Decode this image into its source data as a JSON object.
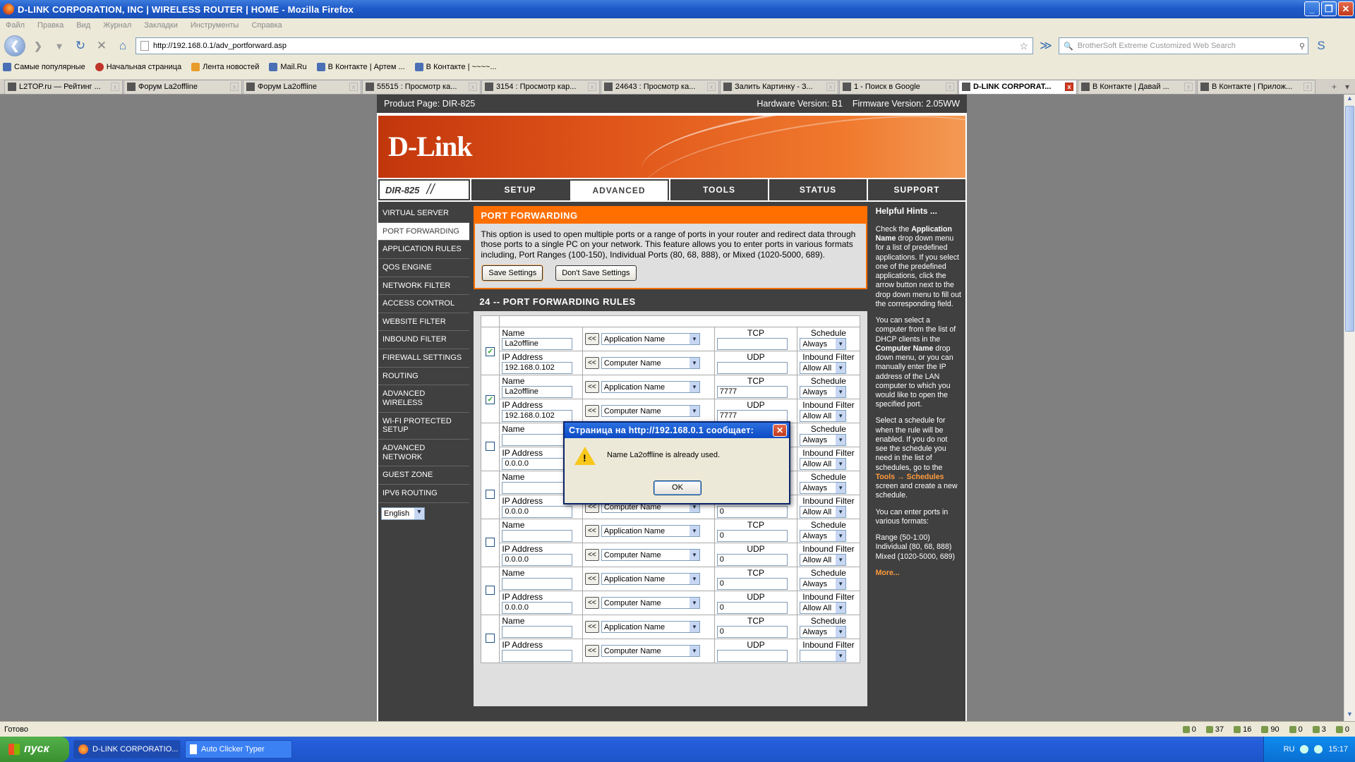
{
  "window": {
    "title": "D-LINK CORPORATION, INC | WIRELESS ROUTER | HOME - Mozilla Firefox"
  },
  "menu": [
    "Файл",
    "Правка",
    "Вид",
    "Журнал",
    "Закладки",
    "Инструменты",
    "Справка"
  ],
  "nav": {
    "url": "http://192.168.0.1/adv_portforward.asp",
    "search_placeholder": "BrotherSoft Extreme Customized Web Search"
  },
  "bookmarks": [
    "Самые популярные",
    "Начальная страница",
    "Лента новостей",
    "Mail.Ru",
    "В Контакте | Артем ...",
    "В Контакте | ~~~~..."
  ],
  "tabs": [
    {
      "label": "L2TOP.ru — Рейтинг ..."
    },
    {
      "label": "Форум La2offline"
    },
    {
      "label": "Форум La2offline"
    },
    {
      "label": "55515 : Просмотр ка..."
    },
    {
      "label": "3154 : Просмотр кар..."
    },
    {
      "label": "24643 : Просмотр ка..."
    },
    {
      "label": "Залить Картинку - З..."
    },
    {
      "label": "1 - Поиск в Google"
    },
    {
      "label": "D-LINK CORPORAT...",
      "active": true
    },
    {
      "label": "В Контакте | Давай ..."
    },
    {
      "label": "В Контакте | Прилож..."
    }
  ],
  "router": {
    "product_page": "Product Page: DIR-825",
    "hardware": "Hardware Version: B1",
    "firmware": "Firmware Version: 2.05WW",
    "logo": "D-Link",
    "model": "DIR-825",
    "topnav": [
      "SETUP",
      "ADVANCED",
      "TOOLS",
      "STATUS",
      "SUPPORT"
    ],
    "sidenav": [
      "VIRTUAL SERVER",
      "PORT FORWARDING",
      "APPLICATION RULES",
      "QOS ENGINE",
      "NETWORK FILTER",
      "ACCESS CONTROL",
      "WEBSITE FILTER",
      "INBOUND FILTER",
      "FIREWALL SETTINGS",
      "ROUTING",
      "ADVANCED WIRELESS",
      "WI-FI PROTECTED SETUP",
      "ADVANCED NETWORK",
      "GUEST ZONE",
      "IPV6 ROUTING"
    ],
    "language": "English",
    "pf_title": "PORT FORWARDING",
    "pf_desc": "This option is used to open multiple ports or a range of ports in your router and redirect data through those ports to a single PC on your network. This feature allows you to enter ports in various formats including, Port Ranges (100-150), Individual Ports (80, 68, 888), or Mixed (1020-5000, 689).",
    "save_label": "Save Settings",
    "dont_save_label": "Don't Save Settings",
    "rules_title": "24 -- PORT FORWARDING RULES",
    "labels": {
      "name": "Name",
      "ip": "IP Address",
      "tcp": "TCP",
      "udp": "UDP",
      "schedule": "Schedule",
      "inbound": "Inbound Filter",
      "app_name": "Application Name",
      "computer_name": "Computer Name",
      "arrow": "<<"
    },
    "rules": [
      {
        "checked": true,
        "name": "La2offline",
        "ip": "192.168.0.102",
        "tcp": "",
        "udp": "",
        "schedule": "Always",
        "inbound": "Allow All"
      },
      {
        "checked": true,
        "name": "La2offline",
        "ip": "192.168.0.102",
        "tcp": "7777",
        "udp": "7777",
        "schedule": "Always",
        "inbound": "Allow All"
      },
      {
        "checked": false,
        "name": "",
        "ip": "0.0.0.0",
        "tcp": "0",
        "udp": "0",
        "schedule": "Always",
        "inbound": "Allow All"
      },
      {
        "checked": false,
        "name": "",
        "ip": "0.0.0.0",
        "tcp": "0",
        "udp": "0",
        "schedule": "Always",
        "inbound": "Allow All"
      },
      {
        "checked": false,
        "name": "",
        "ip": "0.0.0.0",
        "tcp": "0",
        "udp": "0",
        "schedule": "Always",
        "inbound": "Allow All"
      },
      {
        "checked": false,
        "name": "",
        "ip": "0.0.0.0",
        "tcp": "0",
        "udp": "0",
        "schedule": "Always",
        "inbound": "Allow All"
      },
      {
        "checked": false,
        "name": "",
        "ip": "",
        "tcp": "0",
        "udp": "",
        "schedule": "Always",
        "inbound": ""
      }
    ],
    "hints": {
      "title": "Helpful Hints ...",
      "p1a": "Check the",
      "p1b": "Application Name",
      "p1c": "drop down menu for a list of predefined applications. If you select one of the predefined applications, click the arrow button next to the drop down menu to fill out the corresponding field.",
      "p2a": "You can select a computer from the list of DHCP clients in the",
      "p2b": "Computer Name",
      "p2c": "drop down menu, or you can manually enter the IP address of the LAN computer to which you would like to open the specified port.",
      "p3a": "Select a schedule for when the rule will be enabled. If you do not see the schedule you need in the list of schedules, go to the",
      "p3b": "Tools → Schedules",
      "p3c": "screen and create a new schedule.",
      "p4": "You can enter ports in various formats:",
      "p5a": "Range (50-1:00)",
      "p5b": "Individual (80, 68, 888)",
      "p5c": "Mixed (1020-5000, 689)",
      "more": "More..."
    }
  },
  "dialog": {
    "title": "Страница на http://192.168.0.1 сообщает:",
    "message": "Name La2offline is already used.",
    "ok": "OK"
  },
  "status": {
    "text": "Готово",
    "counts": [
      "0",
      "37",
      "16",
      "90",
      "0",
      "3",
      "0"
    ]
  },
  "taskbar": {
    "start": "пуск",
    "tasks": [
      "D-LINK CORPORATIO...",
      "Auto Clicker Typer"
    ],
    "lang": "RU",
    "time": "15:17"
  }
}
